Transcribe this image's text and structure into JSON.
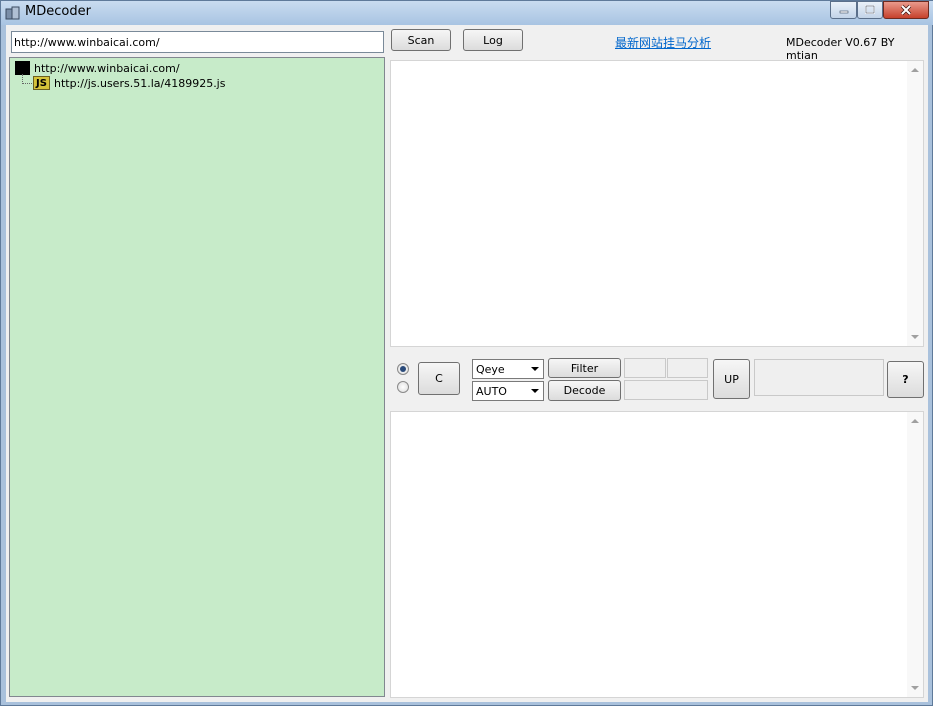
{
  "window": {
    "title": "MDecoder",
    "controls": [
      "minimize",
      "maximize",
      "close"
    ]
  },
  "toolbar": {
    "url_value": "http://www.winbaicai.com/",
    "scan_label": "Scan",
    "log_label": "Log",
    "link_text": "最新网站挂马分析",
    "version_text": "MDecoder V0.67  BY mtian"
  },
  "tree": {
    "items": [
      {
        "label": "http://www.winbaicai.com/",
        "icon": "page-icon"
      },
      {
        "label": "http://js.users.51.la/4189925.js",
        "icon": "js-icon",
        "icon_text": "JS"
      }
    ]
  },
  "controls": {
    "radio_options": [
      {
        "checked": true
      },
      {
        "checked": false
      }
    ],
    "c_label": "C",
    "select_a_value": "Qeye",
    "select_b_value": "AUTO",
    "filter_label": "Filter",
    "decode_label": "Decode",
    "up_label": "UP",
    "help_label": "?"
  },
  "colors": {
    "tree_background": "#c7ebc9",
    "link_color": "#0066cc",
    "title_bar": "#a8c4e2"
  }
}
